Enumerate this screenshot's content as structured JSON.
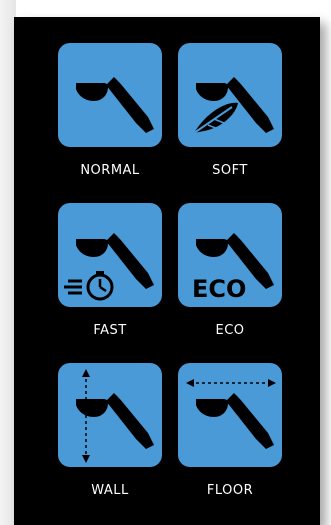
{
  "modes": {
    "normal": {
      "label": "NORMAL",
      "icon": "sweep-head-icon"
    },
    "soft": {
      "label": "SOFT",
      "icon": "feather-icon"
    },
    "fast": {
      "label": "FAST",
      "icon": "stopwatch-icon"
    },
    "eco": {
      "label": "ECO",
      "icon": "eco-text-icon",
      "badge": "ECO"
    },
    "wall": {
      "label": "WALL",
      "icon": "vertical-arrow-icon"
    },
    "floor": {
      "label": "FLOOR",
      "icon": "horizontal-arrow-icon"
    }
  },
  "colors": {
    "tile": "#4a9ad8",
    "panel": "#000000",
    "icon": "#000000",
    "text": "#ffffff"
  }
}
